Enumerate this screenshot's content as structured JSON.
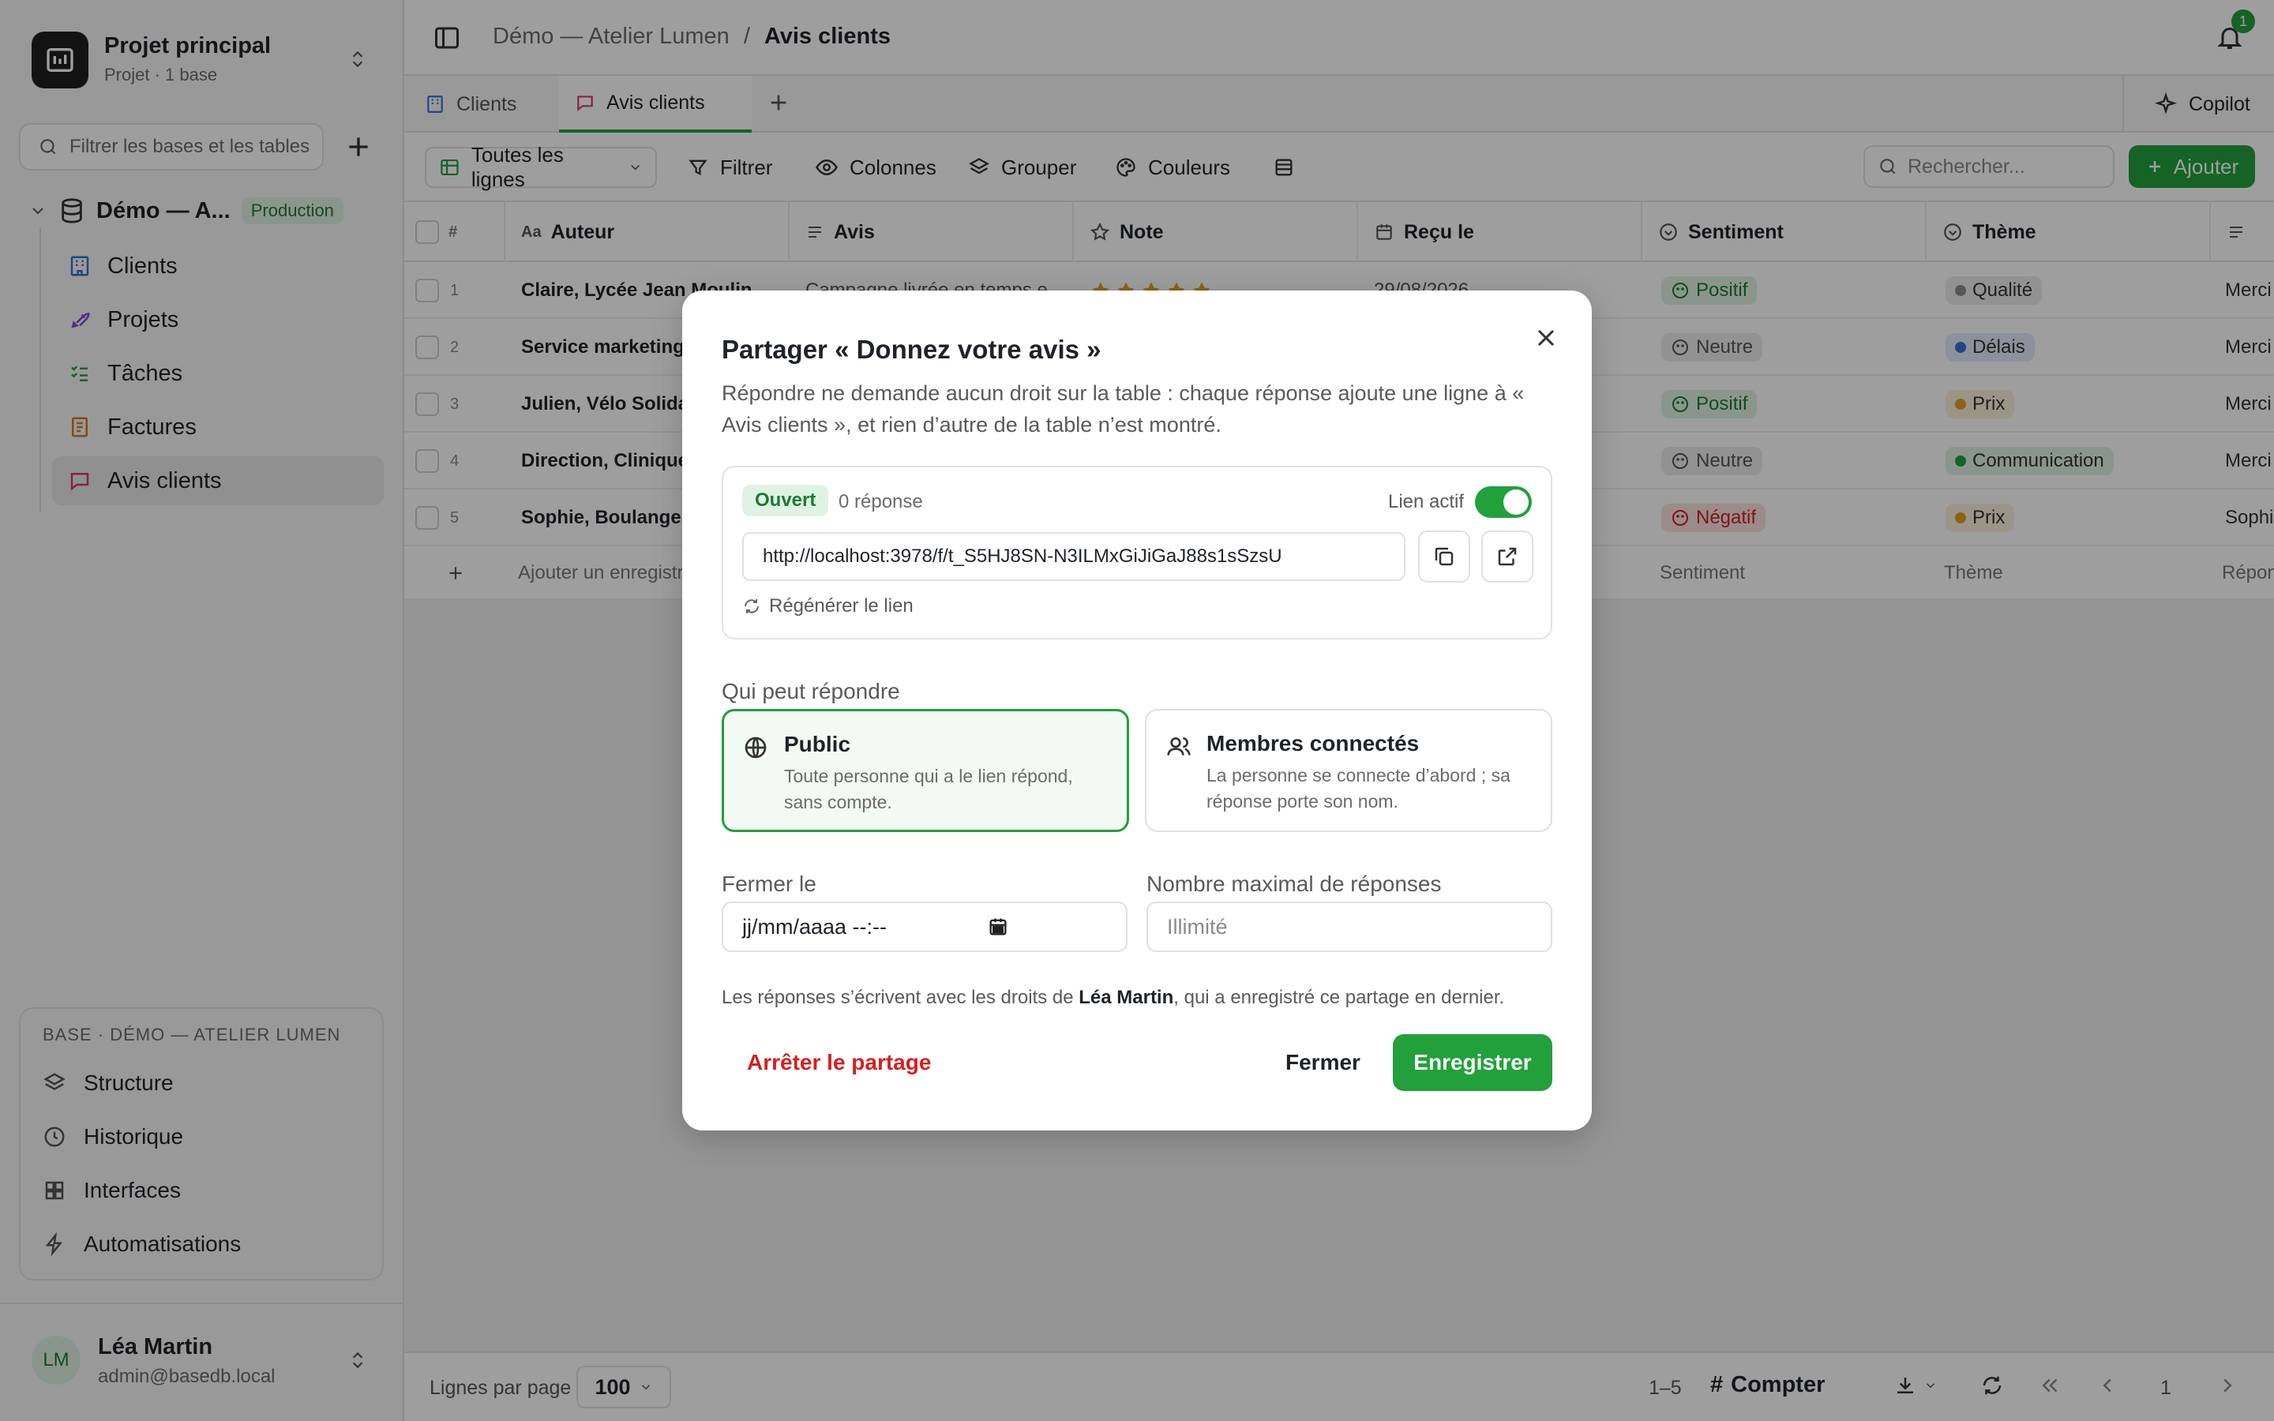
{
  "project": {
    "name": "Projet principal",
    "sub": "Projet · 1 base"
  },
  "sidebar": {
    "filter_placeholder": "Filtrer les bases et les tables",
    "db_name": "Démo — A...",
    "db_badge": "Production",
    "tables": [
      {
        "label": "Clients",
        "icon": "building-icon",
        "color": "#3b6fd4"
      },
      {
        "label": "Projets",
        "icon": "rocket-icon",
        "color": "#7a4bd4"
      },
      {
        "label": "Tâches",
        "icon": "checklist-icon",
        "color": "#22a03c"
      },
      {
        "label": "Factures",
        "icon": "invoice-icon",
        "color": "#d47a1f"
      },
      {
        "label": "Avis clients",
        "icon": "message-icon",
        "color": "#d63a6a"
      }
    ],
    "base_title": "BASE · DÉMO — ATELIER LUMEN",
    "base_items": [
      "Structure",
      "Historique",
      "Interfaces",
      "Automatisations"
    ],
    "user": {
      "initials": "LM",
      "name": "Léa Martin",
      "email": "admin@basedb.local"
    }
  },
  "header": {
    "crumb_base": "Démo — Atelier Lumen",
    "crumb_sep": "/",
    "crumb_table": "Avis clients",
    "notif_count": "1"
  },
  "tabs": {
    "clients": "Clients",
    "avis": "Avis clients",
    "copilot": "Copilot"
  },
  "toolbar": {
    "view": "Toutes les lignes",
    "filter": "Filtrer",
    "columns": "Colonnes",
    "group": "Grouper",
    "colors": "Couleurs",
    "search_placeholder": "Rechercher...",
    "add": "Ajouter"
  },
  "grid": {
    "columns": {
      "num": "#",
      "author": "Auteur",
      "avis": "Avis",
      "note": "Note",
      "received": "Reçu le",
      "sentiment": "Sentiment",
      "theme": "Thème"
    },
    "rows": [
      {
        "n": "1",
        "author": "Claire, Lycée Jean Moulin",
        "avis": "Campagne livrée en temps e",
        "received": "29/08/2026",
        "sentiment": "Positif",
        "theme": "Qualité",
        "reply": "Merci"
      },
      {
        "n": "2",
        "author": "Service marketing,",
        "sentiment": "Neutre",
        "theme": "Délais",
        "reply": "Merci"
      },
      {
        "n": "3",
        "author": "Julien, Vélo Solidair",
        "sentiment": "Positif",
        "theme": "Prix",
        "reply": "Merci"
      },
      {
        "n": "4",
        "author": "Direction, Clinique",
        "sentiment": "Neutre",
        "theme": "Communication",
        "reply": "Merci"
      },
      {
        "n": "5",
        "author": "Sophie, Boulangeri",
        "sentiment": "Négatif",
        "theme": "Prix",
        "reply": "Sophi"
      }
    ],
    "add_row": "Ajouter un enregistr",
    "add_sentiment": "Sentiment",
    "add_theme": "Thème",
    "add_reply": "Répon"
  },
  "footer": {
    "rows_label": "Lignes par page",
    "rows_value": "100",
    "range": "1–5",
    "count": "Compter",
    "page": "1"
  },
  "modal": {
    "title": "Partager « Donnez votre avis »",
    "desc": "Répondre ne demande aucun droit sur la table : chaque réponse ajoute une ligne à « Avis clients », et rien d’autre de la table n’est montré.",
    "status": "Ouvert",
    "responses": "0 réponse",
    "link_active": "Lien actif",
    "url": "http://localhost:3978/f/t_S5HJ8SN-N3ILMxGiJiGaJ88s1sSzsU",
    "regen": "Régénérer le lien",
    "who_label": "Qui peut répondre",
    "public_title": "Public",
    "public_desc": "Toute personne qui a le lien répond, sans compte.",
    "members_title": "Membres connectés",
    "members_desc": "La personne se connecte d’abord ; sa réponse porte son nom.",
    "close_label": "Fermer le",
    "date_placeholder": "jj/mm/aaaa --:--",
    "max_label": "Nombre maximal de réponses",
    "max_placeholder": "Illimité",
    "note_prefix": "Les réponses s’écrivent avec les droits de ",
    "note_user": "Léa Martin",
    "note_suffix": ", qui a enregistré ce partage en dernier.",
    "stop": "Arrêter le partage",
    "close": "Fermer",
    "save": "Enregistrer"
  },
  "colors": {
    "accent": "#22a03c",
    "danger": "#d61f1f"
  }
}
